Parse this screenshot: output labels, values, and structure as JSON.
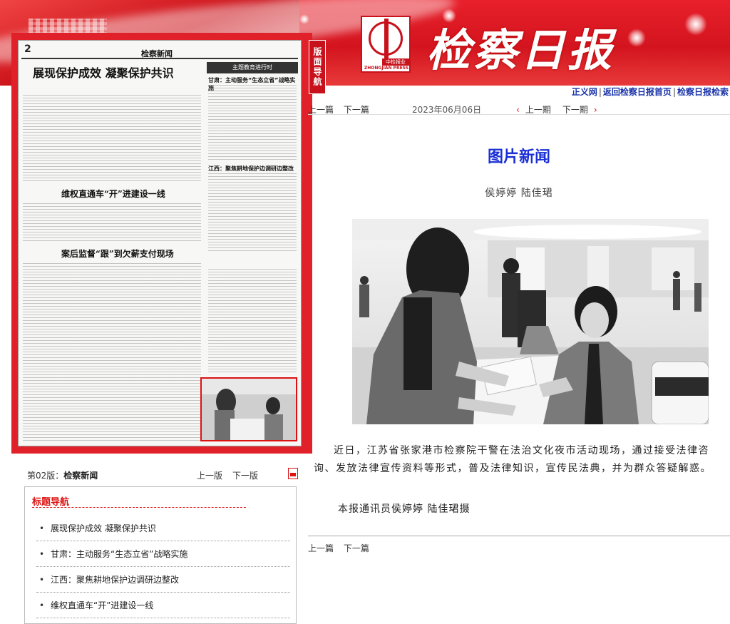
{
  "masthead": {
    "title": "检察日报",
    "logo_badge": "中检报业",
    "logo_en": "ZHONGJIAN PRESS",
    "nav_tag": "版面导航"
  },
  "top_links": [
    {
      "label": "正义网"
    },
    {
      "label": "返回检察日报首页"
    },
    {
      "label": "检察日报检索"
    }
  ],
  "page_thumb": {
    "page_number": "2",
    "section": "检察新闻",
    "headline1": "展现保护成效  凝聚保护共识",
    "headline2": "维权直通车“开”进建设一线",
    "headline3": "案后监督“跟”到欠薪支付现场",
    "side_banner": "主题教育进行时",
    "side_head1": "甘肃：主动服务“生态立省”战略实施",
    "side_head2": "江西：聚焦耕地保护边调研边整改"
  },
  "article_nav": {
    "prev_article": "上一篇",
    "next_article": "下一篇",
    "date": "2023年06月06日",
    "prev_period": "上一期",
    "next_period": "下一期"
  },
  "article": {
    "title": "图片新闻",
    "authors": "侯婷婷  陆佳珺",
    "body": "近日，江苏省张家港市检察院干警在法治文化夜市活动现场，通过接受法律咨询、发放法律宣传资料等形式，普及法律知识，宣传民法典，并为群众答疑解惑。",
    "credit": "本报通讯员侯婷婷  陆佳珺摄"
  },
  "edition": {
    "label_prefix": "第02版：",
    "label_name": "检察新闻",
    "prev": "上一版",
    "next": "下一版"
  },
  "title_nav": {
    "heading": "标题导航",
    "items": [
      {
        "label": "展现保护成效  凝聚保护共识"
      },
      {
        "label": "甘肃：主动服务“生态立省”战略实施"
      },
      {
        "label": "江西：聚焦耕地保护边调研边整改"
      },
      {
        "label": "维权直通车“开”进建设一线"
      }
    ]
  },
  "colors": {
    "brand_red": "#d3141e",
    "title_blue": "#1a2fd6",
    "link_blue": "#1a33aa"
  }
}
